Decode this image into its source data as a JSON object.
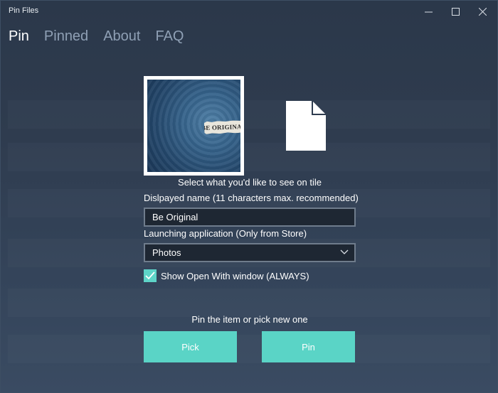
{
  "window": {
    "title": "Pin Files",
    "controls": {
      "minimize": "minimize-icon",
      "maximize": "maximize-icon",
      "close": "close-icon"
    }
  },
  "nav": {
    "tabs": [
      {
        "label": "Pin",
        "active": true
      },
      {
        "label": "Pinned",
        "active": false
      },
      {
        "label": "About",
        "active": false
      },
      {
        "label": "FAQ",
        "active": false
      }
    ]
  },
  "tile": {
    "image_text": "BE ORIGINAL",
    "file_icon": "document-icon",
    "caption": "Select what you'd like to see on tile"
  },
  "form": {
    "name_label": "Dislpayed name (11 characters max. recommended)",
    "name_value": "Be Original",
    "app_label": "Launching application (Only from Store)",
    "app_value": "Photos",
    "checkbox_label": "Show Open With window (ALWAYS)",
    "checkbox_checked": true
  },
  "actions": {
    "prompt": "Pin the item or pick new one",
    "pick_label": "Pick",
    "pin_label": "Pin"
  },
  "colors": {
    "accent": "#5ad4c6",
    "background": "#2f3c4f",
    "input_background": "#1e2733"
  }
}
